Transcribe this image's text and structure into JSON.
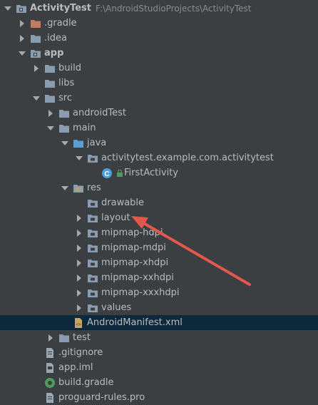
{
  "colors": {
    "background": "#3c3f41",
    "text": "#bbbbbb",
    "folder": "#8a9db0",
    "source_folder": "#5a9fd4",
    "excluded_folder": "#c27a61",
    "selection": "#0d293e",
    "annotation_arrow": "#e2584d"
  },
  "tree": [
    {
      "label": "ActivityTest",
      "path": "F:\\AndroidStudioProjects\\ActivityTest",
      "depth": 0,
      "arrow": "down",
      "icon": "project-module-icon",
      "bold": true
    },
    {
      "label": ".gradle",
      "depth": 1,
      "arrow": "right",
      "icon": "excluded-folder-icon"
    },
    {
      "label": ".idea",
      "depth": 1,
      "arrow": "right",
      "icon": "folder-icon"
    },
    {
      "label": "app",
      "depth": 1,
      "arrow": "down",
      "icon": "module-folder-icon",
      "bold": true
    },
    {
      "label": "build",
      "depth": 2,
      "arrow": "right",
      "icon": "folder-icon"
    },
    {
      "label": "libs",
      "depth": 2,
      "arrow": "none",
      "icon": "folder-icon"
    },
    {
      "label": "src",
      "depth": 2,
      "arrow": "down",
      "icon": "folder-icon"
    },
    {
      "label": "androidTest",
      "depth": 3,
      "arrow": "right",
      "icon": "folder-icon"
    },
    {
      "label": "main",
      "depth": 3,
      "arrow": "down",
      "icon": "folder-icon"
    },
    {
      "label": "java",
      "depth": 4,
      "arrow": "down",
      "icon": "source-folder-icon"
    },
    {
      "label": "activitytest.example.com.activitytest",
      "depth": 5,
      "arrow": "down",
      "icon": "package-folder-icon"
    },
    {
      "label": "FirstActivity",
      "depth": 6,
      "arrow": "none",
      "icon": "class-icon"
    },
    {
      "label": "res",
      "depth": 4,
      "arrow": "down",
      "icon": "resource-folder-icon"
    },
    {
      "label": "drawable",
      "depth": 5,
      "arrow": "none",
      "icon": "package-folder-icon"
    },
    {
      "label": "layout",
      "depth": 5,
      "arrow": "right",
      "icon": "package-folder-icon"
    },
    {
      "label": "mipmap-hdpi",
      "depth": 5,
      "arrow": "right",
      "icon": "package-folder-icon"
    },
    {
      "label": "mipmap-mdpi",
      "depth": 5,
      "arrow": "right",
      "icon": "package-folder-icon"
    },
    {
      "label": "mipmap-xhdpi",
      "depth": 5,
      "arrow": "right",
      "icon": "package-folder-icon"
    },
    {
      "label": "mipmap-xxhdpi",
      "depth": 5,
      "arrow": "right",
      "icon": "package-folder-icon"
    },
    {
      "label": "mipmap-xxxhdpi",
      "depth": 5,
      "arrow": "right",
      "icon": "package-folder-icon"
    },
    {
      "label": "values",
      "depth": 5,
      "arrow": "right",
      "icon": "package-folder-icon"
    },
    {
      "label": "AndroidManifest.xml",
      "depth": 4,
      "arrow": "none",
      "icon": "xml-file-icon",
      "selected": true
    },
    {
      "label": "test",
      "depth": 3,
      "arrow": "right",
      "icon": "folder-icon"
    },
    {
      "label": ".gitignore",
      "depth": 2,
      "arrow": "none",
      "icon": "text-file-icon"
    },
    {
      "label": "app.iml",
      "depth": 2,
      "arrow": "none",
      "icon": "iml-file-icon"
    },
    {
      "label": "build.gradle",
      "depth": 2,
      "arrow": "none",
      "icon": "gradle-file-icon"
    },
    {
      "label": "proguard-rules.pro",
      "depth": 2,
      "arrow": "none",
      "icon": "text-file-icon"
    }
  ]
}
